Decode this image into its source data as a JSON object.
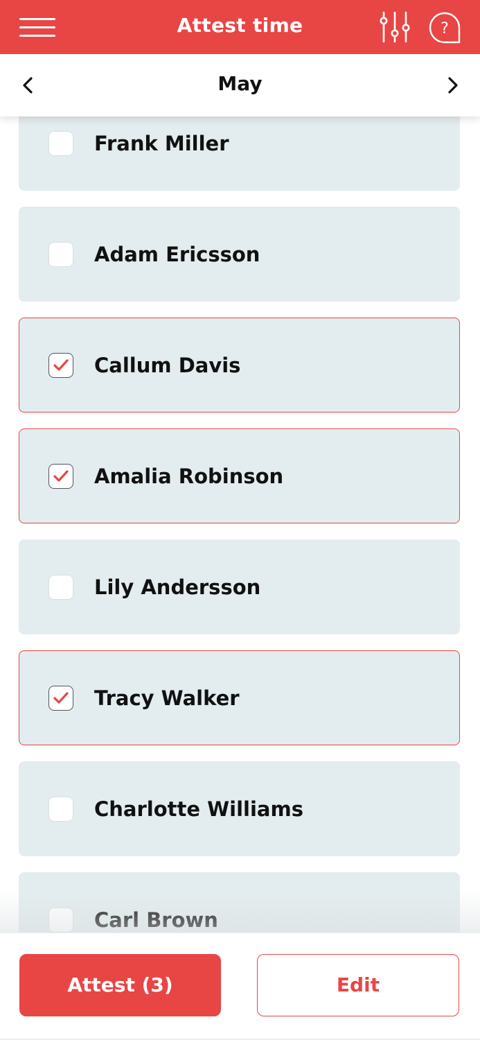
{
  "header": {
    "title": "Attest time",
    "menu_icon": "menu-icon",
    "filter_icon": "sliders-icon",
    "help_icon": "help-icon",
    "background_color": "#E84545"
  },
  "month_nav": {
    "label": "May",
    "prev_icon": "chevron-left-icon",
    "next_icon": "chevron-right-icon"
  },
  "employees": [
    {
      "name": "Frank Miller",
      "selected": false
    },
    {
      "name": "Adam Ericsson",
      "selected": false
    },
    {
      "name": "Callum Davis",
      "selected": true
    },
    {
      "name": "Amalia Robinson",
      "selected": true
    },
    {
      "name": "Lily Andersson",
      "selected": false
    },
    {
      "name": "Tracy Walker",
      "selected": true
    },
    {
      "name": "Charlotte Williams",
      "selected": false
    },
    {
      "name": "Carl Brown",
      "selected": false
    }
  ],
  "actions": {
    "attest_label": "Attest (3)",
    "edit_label": "Edit"
  },
  "colors": {
    "accent": "#E84545",
    "card_background": "#E3ECEE",
    "text": "#111111"
  }
}
